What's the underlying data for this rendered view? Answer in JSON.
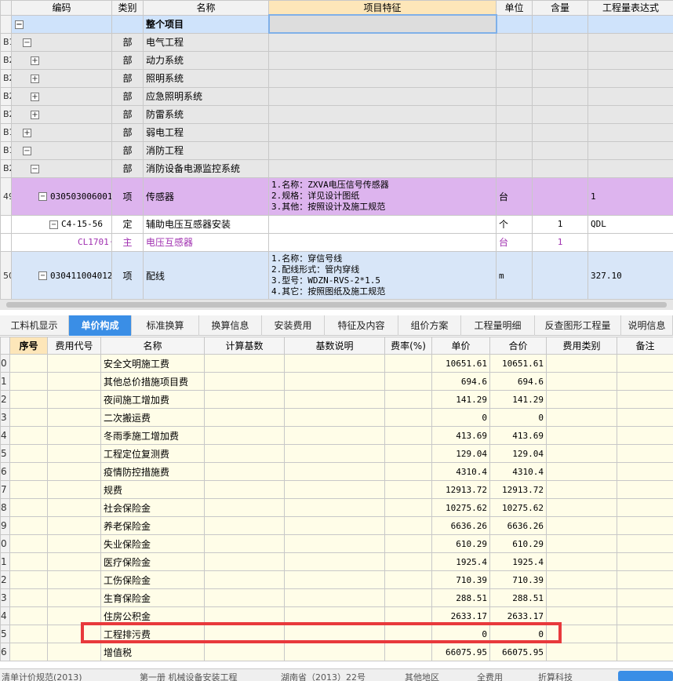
{
  "top_table": {
    "headers": [
      "编码",
      "类别",
      "名称",
      "项目特征",
      "单位",
      "含量",
      "工程量表达式"
    ],
    "rows": [
      {
        "num": "",
        "code": "",
        "type": "",
        "name": "整个项目",
        "feature": "",
        "unit": "",
        "qty": "",
        "expr": "",
        "kind": "root",
        "toggle": "−",
        "indent": 0
      },
      {
        "num": "B1",
        "code": "",
        "type": "部",
        "name": "电气工程",
        "feature": "",
        "unit": "",
        "qty": "",
        "expr": "",
        "kind": "part",
        "toggle": "−",
        "indent": 1
      },
      {
        "num": "B2",
        "code": "",
        "type": "部",
        "name": "动力系统",
        "feature": "",
        "unit": "",
        "qty": "",
        "expr": "",
        "kind": "part",
        "toggle": "+",
        "indent": 2
      },
      {
        "num": "B2",
        "code": "",
        "type": "部",
        "name": "照明系统",
        "feature": "",
        "unit": "",
        "qty": "",
        "expr": "",
        "kind": "part",
        "toggle": "+",
        "indent": 2
      },
      {
        "num": "B2",
        "code": "",
        "type": "部",
        "name": "应急照明系统",
        "feature": "",
        "unit": "",
        "qty": "",
        "expr": "",
        "kind": "part",
        "toggle": "+",
        "indent": 2
      },
      {
        "num": "B2",
        "code": "",
        "type": "部",
        "name": "防雷系统",
        "feature": "",
        "unit": "",
        "qty": "",
        "expr": "",
        "kind": "part",
        "toggle": "+",
        "indent": 2
      },
      {
        "num": "B1",
        "code": "",
        "type": "部",
        "name": "弱电工程",
        "feature": "",
        "unit": "",
        "qty": "",
        "expr": "",
        "kind": "part",
        "toggle": "+",
        "indent": 1
      },
      {
        "num": "B1",
        "code": "",
        "type": "部",
        "name": "消防工程",
        "feature": "",
        "unit": "",
        "qty": "",
        "expr": "",
        "kind": "part",
        "toggle": "−",
        "indent": 1
      },
      {
        "num": "B2",
        "code": "",
        "type": "部",
        "name": "消防设备电源监控系统",
        "feature": "",
        "unit": "",
        "qty": "",
        "expr": "",
        "kind": "part",
        "toggle": "−",
        "indent": 2
      }
    ],
    "item1": {
      "num": "49",
      "code": "030503006001",
      "type": "项",
      "name": "传感器",
      "feature": "1.名称：ZXVA电压信号传感器\n2.规格：详见设计图纸\n3.其他：按照设计及施工规范",
      "unit": "台",
      "qty": "",
      "expr": "1"
    },
    "quota": {
      "code": "C4-15-56",
      "type": "定",
      "name": "辅助电压互感器安装",
      "unit": "个",
      "qty": "1",
      "expr": "QDL"
    },
    "main": {
      "code": "CL1701···",
      "type": "主",
      "name": "电压互感器",
      "unit": "台",
      "qty": "1",
      "expr": ""
    },
    "item2": {
      "num": "50",
      "code": "030411004012",
      "type": "项",
      "name": "配线",
      "feature": "1.名称：穿信号线\n2.配线形式：管内穿线\n3.型号：WDZN-RVS-2*1.5\n4.其它：按照图纸及施工规范",
      "unit": "m",
      "qty": "",
      "expr": "327.10"
    }
  },
  "tabs": [
    "工料机显示",
    "单价构成",
    "标准换算",
    "换算信息",
    "安装费用",
    "特征及内容",
    "组价方案",
    "工程量明细",
    "反查图形工程量",
    "说明信息"
  ],
  "active_tab": "单价构成",
  "bottom_table": {
    "headers": [
      "序号",
      "费用代号",
      "名称",
      "计算基数",
      "基数说明",
      "费率(%)",
      "单价",
      "合价",
      "费用类别",
      "备注"
    ],
    "rows": [
      {
        "num": "0",
        "name": "安全文明施工费",
        "price": "10651.61",
        "total": "10651.61"
      },
      {
        "num": "1",
        "name": "其他总价措施项目费",
        "price": "694.6",
        "total": "694.6"
      },
      {
        "num": "2",
        "name": "夜间施工增加费",
        "price": "141.29",
        "total": "141.29"
      },
      {
        "num": "3",
        "name": "二次搬运费",
        "price": "0",
        "total": "0"
      },
      {
        "num": "4",
        "name": "冬雨季施工增加费",
        "price": "413.69",
        "total": "413.69"
      },
      {
        "num": "5",
        "name": "工程定位复测费",
        "price": "129.04",
        "total": "129.04"
      },
      {
        "num": "6",
        "name": "疫情防控措施费",
        "price": "4310.4",
        "total": "4310.4"
      },
      {
        "num": "7",
        "name": "规费",
        "price": "12913.72",
        "total": "12913.72"
      },
      {
        "num": "8",
        "name": "社会保险金",
        "price": "10275.62",
        "total": "10275.62"
      },
      {
        "num": "9",
        "name": "养老保险金",
        "price": "6636.26",
        "total": "6636.26"
      },
      {
        "num": "0",
        "name": "失业保险金",
        "price": "610.29",
        "total": "610.29"
      },
      {
        "num": "1",
        "name": "医疗保险金",
        "price": "1925.4",
        "total": "1925.4"
      },
      {
        "num": "2",
        "name": "工伤保险金",
        "price": "710.39",
        "total": "710.39"
      },
      {
        "num": "3",
        "name": "生育保险金",
        "price": "288.51",
        "total": "288.51"
      },
      {
        "num": "4",
        "name": "住房公积金",
        "price": "2633.17",
        "total": "2633.17"
      },
      {
        "num": "5",
        "name": "工程排污费",
        "price": "0",
        "total": "0"
      },
      {
        "num": "6",
        "name": "增值税",
        "price": "66075.95",
        "total": "66075.95"
      }
    ]
  },
  "status_bar": [
    "清单计价规范(2013)",
    "第一册 机械设备安装工程",
    "湖南省（2013）22号",
    "其他地区",
    "全费用",
    "折算科技"
  ],
  "colors": {
    "accent": "#3a8ee6",
    "highlight_box": "#e8393c",
    "item_row": "#ddb4ee",
    "main_material_text": "#a030b0"
  }
}
